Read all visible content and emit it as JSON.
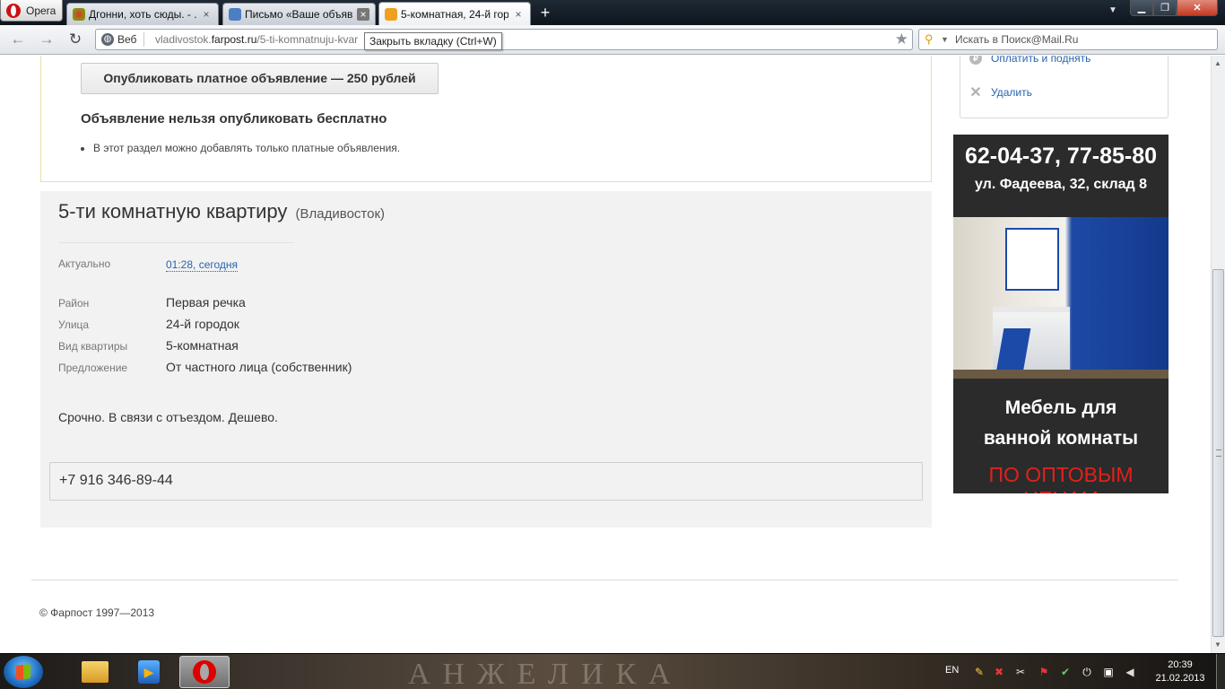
{
  "browser": {
    "opera_label": "Opera",
    "tabs": [
      {
        "title": "Дгонни, хоть сюды. - ...",
        "close": "×"
      },
      {
        "title": "Письмо «Ваше объяв...",
        "close": "×"
      },
      {
        "title": "5-комнатная, 24-й гор...",
        "close": "×"
      }
    ],
    "new_tab": "+",
    "tab_menu": "▼",
    "window": {
      "min": "▁",
      "max": "❐",
      "close": "✕"
    },
    "nav": {
      "back": "←",
      "forward": "→",
      "reload": "↻"
    },
    "address": {
      "badge": "Веб",
      "url_prefix": "vladivostok.",
      "url_domain": "farpost.ru",
      "url_rest": "/5-ti-komnatnuju-kvar",
      "star": "★"
    },
    "tooltip": "Закрыть вкладку (Ctrl+W)",
    "search": {
      "engine": "⚲",
      "caret": "▼",
      "placeholder": "Искать в Поиск@Mail.Ru"
    }
  },
  "page": {
    "paid_button": "Опубликовать платное объявление — 250 рублей",
    "notice_title": "Объявление нельзя опубликовать бесплатно",
    "notice_item": "В этот раздел можно добавлять только платные объявления.",
    "actions": [
      {
        "icon": "₽",
        "label": "Оплатить и поднять"
      },
      {
        "icon": "✕",
        "label": "Удалить"
      }
    ],
    "ad": {
      "title": "5-ти комнатную квартиру",
      "city": "(Владивосток)",
      "updated_label": "Актуально",
      "updated_value": "01:28, сегодня",
      "fields": [
        {
          "label": "Район",
          "value": "Первая речка"
        },
        {
          "label": "Улица",
          "value": "24-й городок"
        },
        {
          "label": "Вид квартиры",
          "value": "5-комнатная"
        },
        {
          "label": "Предложение",
          "value": "От частного лица (собственник)"
        }
      ],
      "text": "Срочно. В связи с отъездом. Дешево.",
      "phone": "+7 916 346-89-44"
    },
    "banner": {
      "phones": "62-04-37, 77-85-80",
      "address": "ул. Фадеева, 32, склад 8",
      "line1": "Мебель для",
      "line2": "ванной комнаты",
      "price": "ПО ОПТОВЫМ ЦЕНАМ"
    },
    "copyright": "© Фарпост 1997—2013"
  },
  "taskbar": {
    "watermark": "АНЖЕЛИКА",
    "lang": "EN",
    "time": "20:39",
    "date": "21.02.2013"
  }
}
